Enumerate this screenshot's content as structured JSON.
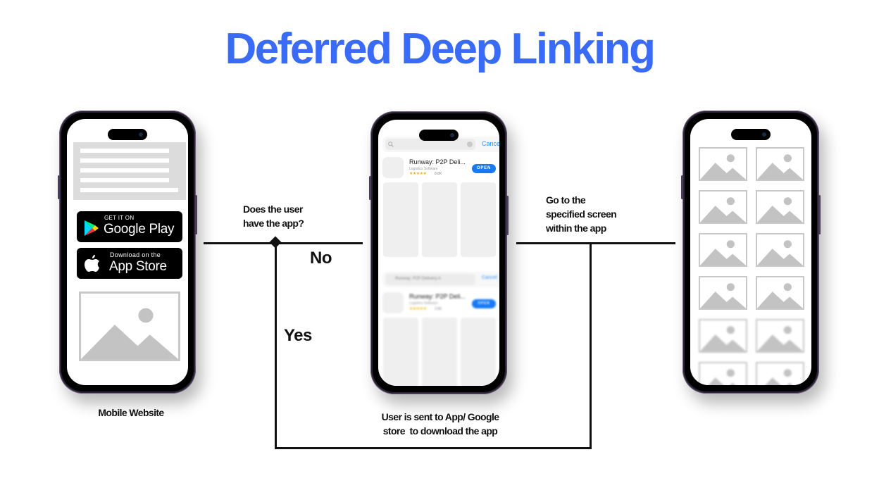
{
  "title": "Deferred Deep Linking",
  "colors": {
    "title": "#3a6bf6",
    "accent_button": "#1779f5",
    "link": "#2f8ff6",
    "star": "#f2b600",
    "placeholder_gray": "#c8c8c8"
  },
  "phones": {
    "mobile_website": {
      "caption": "Mobile Website",
      "google_play": {
        "small": "GET IT ON",
        "big": "Google Play",
        "icon": "play-triangle-icon"
      },
      "app_store": {
        "small": "Download on the",
        "big": "App Store",
        "icon": "apple-icon"
      },
      "image_placeholder_icon": "image-placeholder-icon"
    },
    "app_store_screen": {
      "caption_line1": "User is sent to App/ Google",
      "caption_line2": "store  to download the app",
      "top": {
        "search_icon": "search-icon",
        "clear_icon": "clear-circle-icon",
        "cancel": "Cancel",
        "app_name": "Runway: P2P Deli...",
        "app_category": "Logistics Software",
        "stars": "★★★★★",
        "rating_count": "8.8K",
        "open": "OPEN"
      },
      "bottom": {
        "search_text": "Runway: P2P Delivery A",
        "cancel": "Cancel",
        "app_name": "Runway: P2P Deli...",
        "app_category": "Logistics Software",
        "stars": "★★★★★",
        "rating_count": "3.8K",
        "open": "OPEN"
      }
    },
    "in_app_screen": {
      "grid_rows": 6,
      "grid_cols": 2,
      "image_placeholder_icon": "image-placeholder-icon"
    }
  },
  "flow": {
    "question": {
      "line1": "Does the user",
      "line2": "have the app?"
    },
    "no": "No",
    "yes": "Yes",
    "goto": {
      "line1": "Go to the",
      "line2": "specified screen",
      "line3": "within the app"
    }
  }
}
